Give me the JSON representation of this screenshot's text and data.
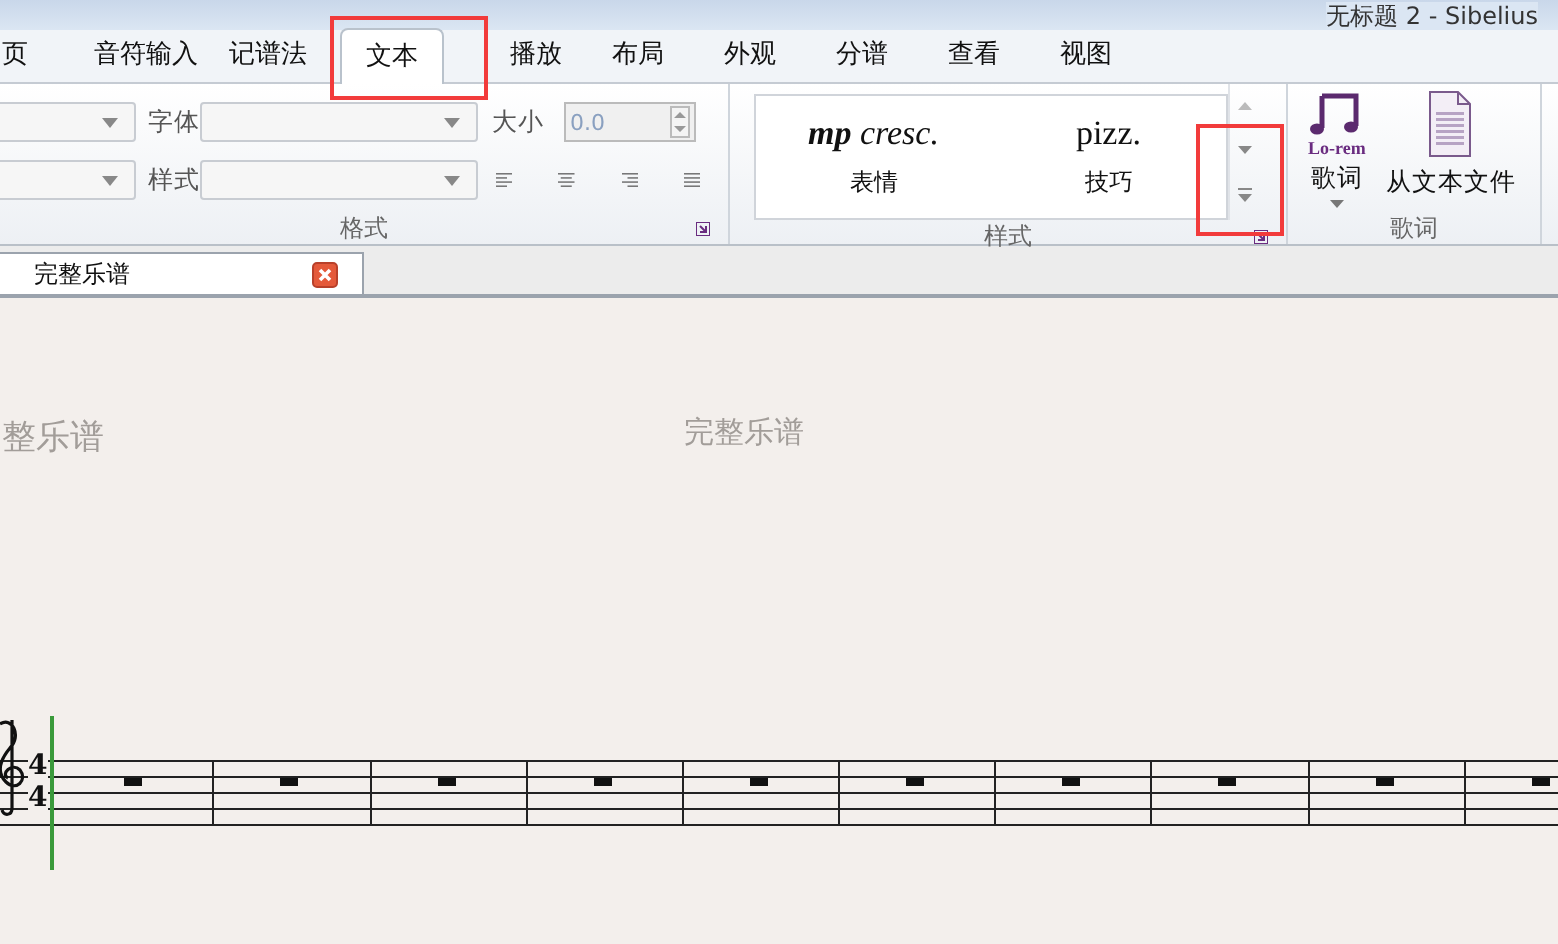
{
  "window": {
    "title": "无标题 2 - Sibelius"
  },
  "tabs": [
    {
      "label": "页",
      "selected": false
    },
    {
      "label": "音符输入",
      "selected": false
    },
    {
      "label": "记谱法",
      "selected": false
    },
    {
      "label": "文本",
      "selected": true
    },
    {
      "label": "播放",
      "selected": false
    },
    {
      "label": "布局",
      "selected": false
    },
    {
      "label": "外观",
      "selected": false
    },
    {
      "label": "分谱",
      "selected": false
    },
    {
      "label": "查看",
      "selected": false
    },
    {
      "label": "视图",
      "selected": false
    }
  ],
  "format_group": {
    "font_label": "字体",
    "size_label": "大小",
    "size_value": "0.0",
    "style_label": "样式",
    "label": "格式"
  },
  "style_group": {
    "items": [
      {
        "sample": "**mp** cresc.",
        "kind": "expression",
        "label": "表情"
      },
      {
        "sample": "pizz.",
        "kind": "technique",
        "label": "技巧"
      }
    ],
    "label": "样式"
  },
  "lyrics_group": {
    "buttons": [
      {
        "label": "歌词",
        "kind": "lyrics"
      },
      {
        "label": "从文本文件",
        "kind": "file"
      }
    ],
    "label": "歌词",
    "icon_text": "Lo-rem"
  },
  "document_tabs": [
    {
      "label": "完整乐谱"
    }
  ],
  "score": {
    "headers": [
      "整乐谱",
      "完整乐谱"
    ],
    "time_signature": [
      "4",
      "4"
    ]
  }
}
